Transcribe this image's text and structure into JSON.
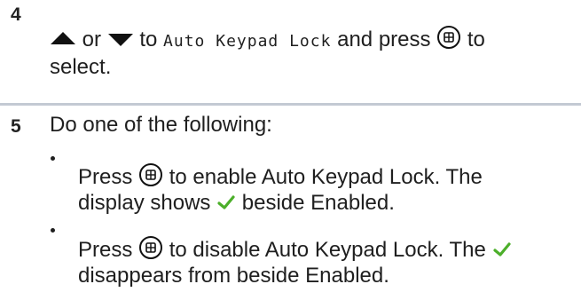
{
  "step4": {
    "number": "4",
    "or_text": "or",
    "to_text": "to",
    "menu_item": "Auto Keypad Lock",
    "and_press": "and press",
    "to_end": "to",
    "select": "select."
  },
  "step5": {
    "number": "5",
    "intro": "Do one of the following:",
    "options": [
      {
        "press": "Press",
        "line1_rest": "to enable Auto Keypad Lock. The",
        "line2_before": "display shows",
        "line2_after": "beside Enabled."
      },
      {
        "press": "Press",
        "line1_rest": "to disable Auto Keypad Lock. The",
        "line2": "disappears from beside Enabled."
      }
    ]
  },
  "colors": {
    "check": "#4caf2a",
    "divider": "#c3c9d3"
  },
  "icons": [
    "up-arrow-icon",
    "down-arrow-icon",
    "menu-ok-button-icon",
    "checkmark-icon"
  ]
}
